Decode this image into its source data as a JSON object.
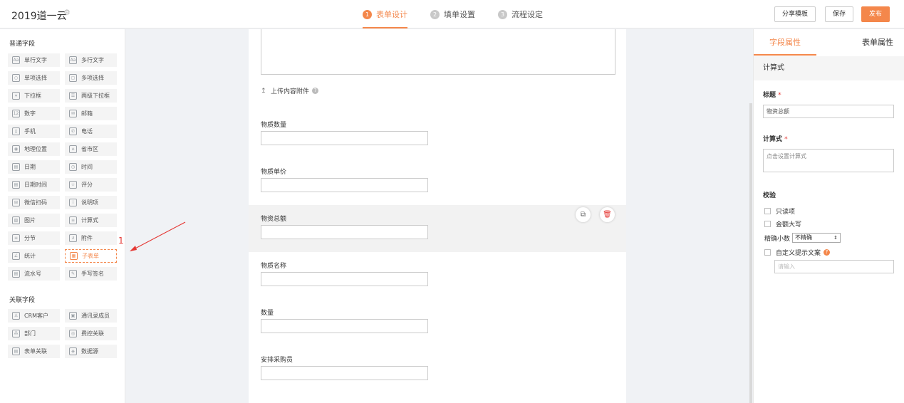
{
  "header": {
    "app_title": "2019道一云",
    "steps": [
      {
        "num": "1",
        "label": "表单设计"
      },
      {
        "num": "2",
        "label": "填单设置"
      },
      {
        "num": "3",
        "label": "流程设定"
      }
    ],
    "share_label": "分享模板",
    "save_label": "保存",
    "publish_label": "发布"
  },
  "left": {
    "common_title": "普通字段",
    "common_items": [
      {
        "icon": "Aa",
        "label": "单行文字"
      },
      {
        "icon": "Aa",
        "label": "多行文字"
      },
      {
        "icon": "○",
        "label": "单项选择"
      },
      {
        "icon": "▢",
        "label": "多项选择"
      },
      {
        "icon": "▾",
        "label": "下拉框"
      },
      {
        "icon": "☰",
        "label": "两级下拉框"
      },
      {
        "icon": "12",
        "label": "数字"
      },
      {
        "icon": "✉",
        "label": "邮箱"
      },
      {
        "icon": "▯",
        "label": "手机"
      },
      {
        "icon": "✆",
        "label": "电话"
      },
      {
        "icon": "◉",
        "label": "地理位置"
      },
      {
        "icon": "⌂",
        "label": "省市区"
      },
      {
        "icon": "▤",
        "label": "日期"
      },
      {
        "icon": "◷",
        "label": "时间"
      },
      {
        "icon": "▤",
        "label": "日期时间"
      },
      {
        "icon": "☆",
        "label": "评分"
      },
      {
        "icon": "⊞",
        "label": "微信扫码"
      },
      {
        "icon": "i",
        "label": "说明项"
      },
      {
        "icon": "▨",
        "label": "图片"
      },
      {
        "icon": "≡",
        "label": "计算式"
      },
      {
        "icon": "≡",
        "label": "分节"
      },
      {
        "icon": "∂",
        "label": "附件"
      },
      {
        "icon": "∠",
        "label": "统计"
      },
      {
        "icon": "▦",
        "label": "子表单"
      },
      {
        "icon": "▤",
        "label": "流水号"
      },
      {
        "icon": "✎",
        "label": "手写签名"
      }
    ],
    "related_title": "关联字段",
    "related_items": [
      {
        "icon": "♙",
        "label": "CRM客户"
      },
      {
        "icon": "▣",
        "label": "通讯录成员"
      },
      {
        "icon": "⁂",
        "label": "部门"
      },
      {
        "icon": "◎",
        "label": "费控关联"
      },
      {
        "icon": "▤",
        "label": "表单关联"
      },
      {
        "icon": "◈",
        "label": "数据源"
      }
    ],
    "annotation_number": "1"
  },
  "canvas": {
    "upload_label": "上传内容附件",
    "upload_icon": "↥",
    "fields": [
      {
        "label": "物质数量"
      },
      {
        "label": "物质单价"
      },
      {
        "label": "物资总额"
      },
      {
        "label": "物质名称"
      },
      {
        "label": "数量"
      },
      {
        "label": "安排采购员"
      }
    ],
    "copy_icon": "⧉",
    "delete_icon": "🗑"
  },
  "right": {
    "tab_field_props": "字段属性",
    "tab_form_props": "表单属性",
    "field_type": "计算式",
    "title_label": "标题",
    "title_value": "物资总额",
    "formula_label": "计算式",
    "formula_placeholder": "点击设置计算式",
    "validate_label": "校验",
    "readonly_label": "只读项",
    "uppercase_label": "金额大写",
    "precision_label": "精确小数",
    "precision_value": "不精确",
    "custom_tip_label": "自定义提示文案",
    "tip_placeholder": "请输入",
    "required_mark": "*"
  },
  "colors": {
    "accent": "#f4874b",
    "annotation": "#e53935"
  }
}
